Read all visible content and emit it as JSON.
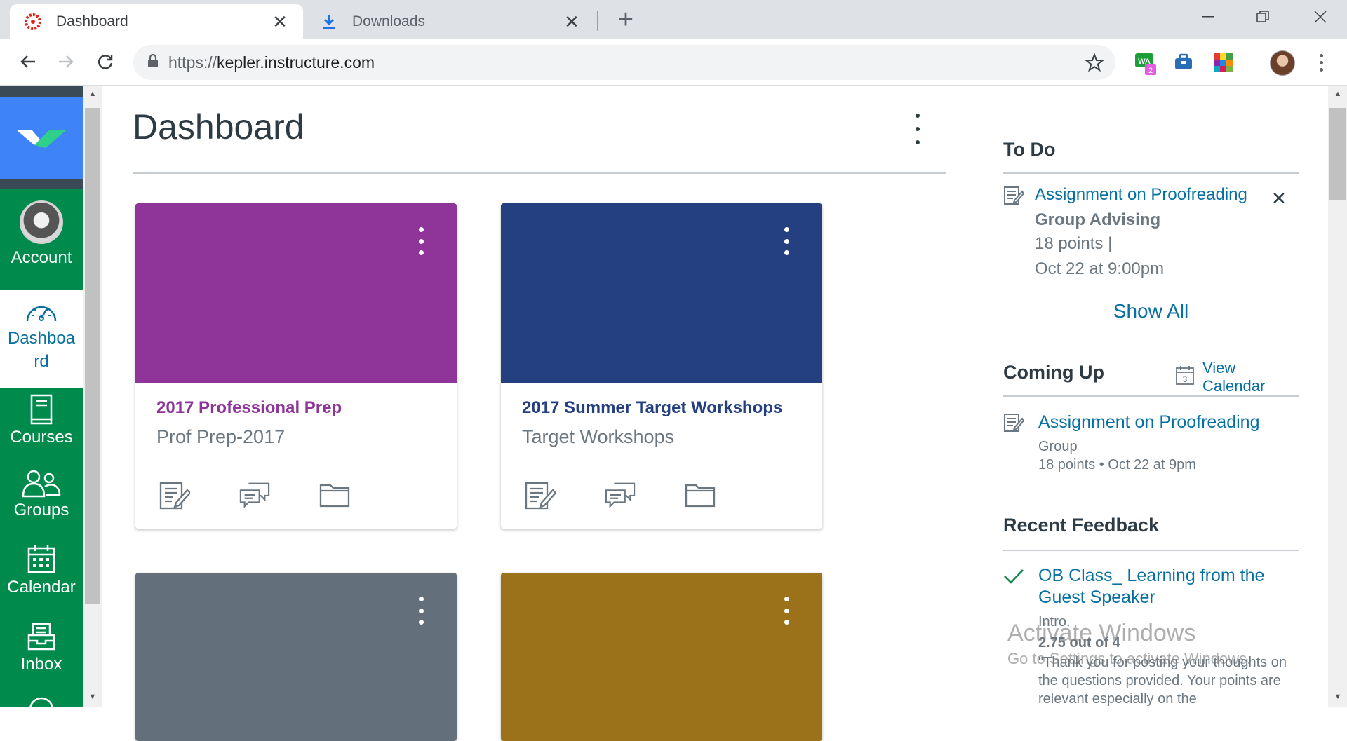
{
  "browser": {
    "tabs": [
      {
        "title": "Dashboard",
        "active": true
      },
      {
        "title": "Downloads",
        "active": false
      }
    ],
    "url_scheme": "https://",
    "url_host": "kepler.instructure.com",
    "extension_badge": "2",
    "extension_label": "WA"
  },
  "nav": {
    "items": [
      {
        "label": "Account"
      },
      {
        "label": "Dashboard"
      },
      {
        "label": "Courses"
      },
      {
        "label": "Groups"
      },
      {
        "label": "Calendar"
      },
      {
        "label": "Inbox"
      }
    ],
    "colors": {
      "nav_bg": "#008b4d",
      "logo_bg": "#3f83f8",
      "active_text": "#0770a3"
    }
  },
  "dashboard": {
    "title": "Dashboard",
    "cards": [
      {
        "name": "2017 Professional Prep",
        "code": "Prof Prep-2017",
        "color": "#8f3499"
      },
      {
        "name": "2017 Summer Target Workshops",
        "code": "Target Workshops",
        "color": "#244081"
      },
      {
        "name": "",
        "code": "",
        "color": "#636f7a"
      },
      {
        "name": "",
        "code": "",
        "color": "#9b7219"
      }
    ],
    "card_actions": [
      "assignments-icon",
      "discussions-icon",
      "files-icon"
    ]
  },
  "sidebar": {
    "todo": {
      "heading": "To Do",
      "title": "Assignment on Proofreading",
      "course": "Group Advising",
      "points": "18 points  |",
      "date": "Oct 22 at 9:00pm",
      "show_all": "Show All"
    },
    "coming_up": {
      "heading": "Coming Up",
      "view_calendar": "View Calendar",
      "calendar_day": "3",
      "title": "Assignment on Proofreading",
      "course": "Group",
      "meta": "18 points • Oct 22 at 9pm"
    },
    "recent_feedback": {
      "heading": "Recent Feedback",
      "title": "OB Class_ Learning from the Guest Speaker",
      "course": "Intro.",
      "score": "2.75 out of 4",
      "comment": "\"Thank you for posting your thoughts on the questions provided. Your points are relevant especially on the"
    }
  },
  "watermark": {
    "line1": "Activate Windows",
    "line2": "Go to Settings to activate Windows."
  }
}
